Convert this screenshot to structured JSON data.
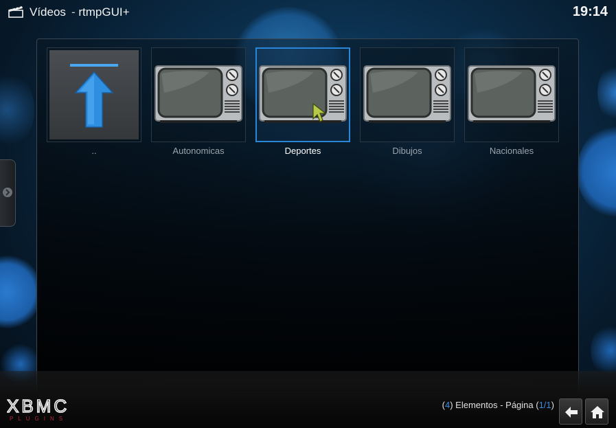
{
  "header": {
    "section": "Vídeos",
    "separator": "-",
    "plugin": "rtmpGUI+",
    "clock": "19:14"
  },
  "items": [
    {
      "label": "..",
      "icon": "up-arrow-icon",
      "selected": false
    },
    {
      "label": "Autonomicas",
      "icon": "tv-folder-icon",
      "selected": false
    },
    {
      "label": "Deportes",
      "icon": "tv-folder-icon",
      "selected": true
    },
    {
      "label": "Dibujos",
      "icon": "tv-folder-icon",
      "selected": false
    },
    {
      "label": "Nacionales",
      "icon": "tv-folder-icon",
      "selected": false
    }
  ],
  "footer": {
    "logo_text": "XBMC",
    "logo_subtext": "PLUGINS",
    "status_open": "(",
    "count": "4",
    "status_mid": ") Elementos - Página (",
    "page": "1/1",
    "status_close": ")",
    "back_icon": "back-arrow-icon",
    "home_icon": "home-icon"
  },
  "colors": {
    "accent": "#2a86d6",
    "logo_red": "#b0283a"
  }
}
